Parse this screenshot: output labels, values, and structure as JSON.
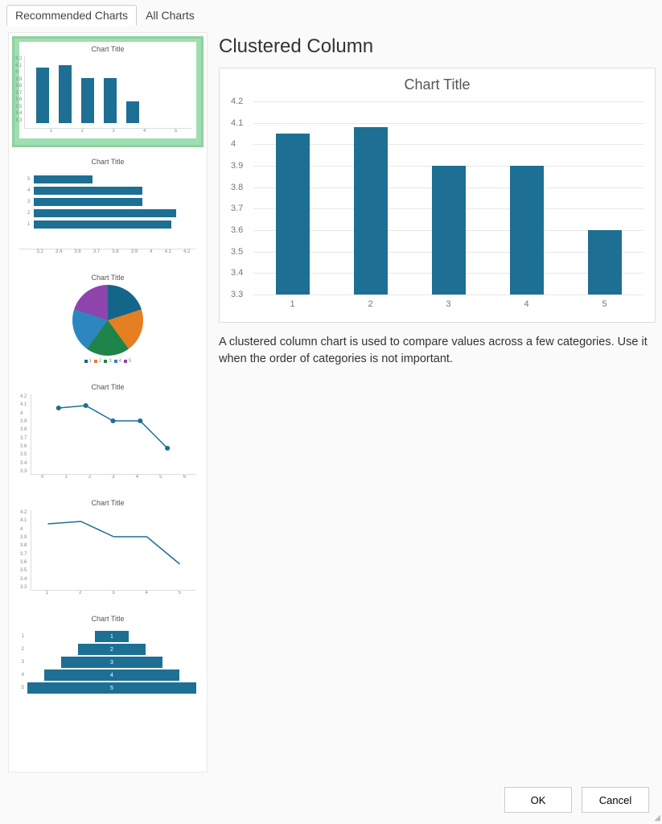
{
  "tabs": {
    "recommended": "Recommended Charts",
    "all": "All Charts"
  },
  "thumbnails": {
    "title": "Chart Title",
    "legend_items": [
      "1",
      "2",
      "3",
      "4",
      "5"
    ]
  },
  "main": {
    "heading": "Clustered Column",
    "chart_title": "Chart Title",
    "description": "A clustered column chart is used to compare values across a few categories. Use it when the order of categories is not important."
  },
  "buttons": {
    "ok": "OK",
    "cancel": "Cancel"
  },
  "chart_data": {
    "type": "bar",
    "title": "Chart Title",
    "xlabel": "",
    "ylabel": "",
    "categories": [
      "1",
      "2",
      "3",
      "4",
      "5"
    ],
    "values": [
      4.05,
      4.08,
      3.9,
      3.9,
      3.6
    ],
    "ylim": [
      3.3,
      4.2
    ],
    "yticks": [
      4.2,
      4.1,
      4.0,
      3.9,
      3.8,
      3.7,
      3.6,
      3.5,
      3.4,
      3.3
    ]
  },
  "sidebar_charts": [
    {
      "type": "column",
      "values": [
        4.05,
        4.08,
        3.9,
        3.9,
        3.6
      ],
      "ylim": [
        3.3,
        4.2
      ]
    },
    {
      "type": "hbar",
      "categories": [
        "5",
        "4",
        "3",
        "2",
        "1"
      ],
      "values": [
        3.6,
        3.9,
        3.9,
        4.08,
        4.05
      ],
      "xlim": [
        3.2,
        4.2
      ]
    },
    {
      "type": "pie",
      "values": [
        20,
        20,
        20,
        20,
        20
      ]
    },
    {
      "type": "scatter_line",
      "x": [
        1,
        2,
        3,
        4,
        5
      ],
      "y": [
        4.05,
        4.08,
        3.9,
        3.9,
        3.6
      ],
      "ylim": [
        3.3,
        4.2
      ]
    },
    {
      "type": "line",
      "x": [
        1,
        2,
        3,
        4,
        5
      ],
      "y": [
        4.05,
        4.08,
        3.9,
        3.9,
        3.6
      ],
      "ylim": [
        3.3,
        4.2
      ]
    },
    {
      "type": "funnel",
      "categories": [
        "1",
        "2",
        "3",
        "4",
        "5"
      ],
      "values": [
        1,
        2,
        3,
        4,
        5
      ]
    }
  ]
}
